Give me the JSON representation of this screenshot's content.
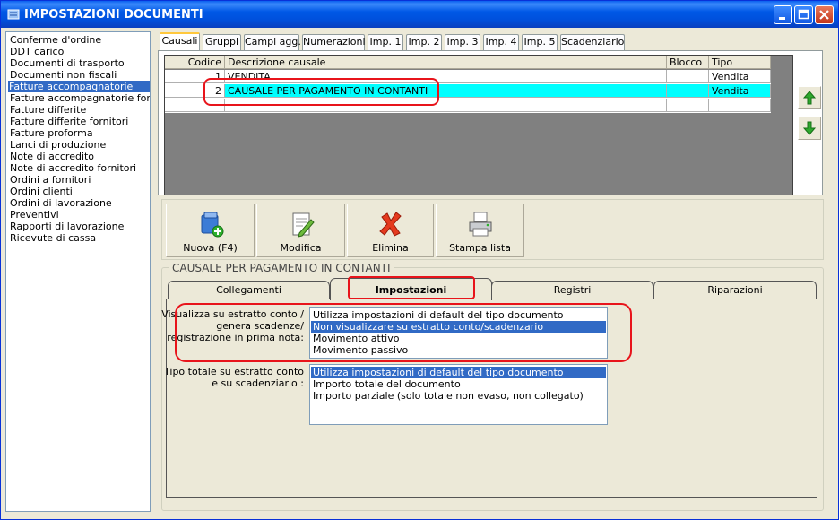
{
  "window": {
    "title": "IMPOSTAZIONI DOCUMENTI"
  },
  "left_list": {
    "items": [
      "Conferme d'ordine",
      "DDT carico",
      "Documenti di trasporto",
      "Documenti non fiscali",
      "Fatture accompagnatorie",
      "Fatture accompagnatorie fornitori",
      "Fatture differite",
      "Fatture differite fornitori",
      "Fatture proforma",
      "Lanci di produzione",
      "Note di accredito",
      "Note di accredito fornitori",
      "Ordini a fornitori",
      "Ordini clienti",
      "Ordini di lavorazione",
      "Preventivi",
      "Rapporti di lavorazione",
      "Ricevute di cassa"
    ],
    "selected_index": 4
  },
  "tabs": [
    "Causali",
    "Gruppi",
    "Campi agg.",
    "Numerazioni",
    "Imp. 1",
    "Imp. 2",
    "Imp. 3",
    "Imp. 4",
    "Imp. 5",
    "Scadenziario"
  ],
  "active_tab": "Causali",
  "grid": {
    "headers": [
      "Codice",
      "Descrizione causale",
      "Blocco",
      "Tipo"
    ],
    "rows": [
      {
        "codice": "1",
        "descrizione": "VENDITA",
        "blocco": "",
        "tipo": "Vendita"
      },
      {
        "codice": "2",
        "descrizione": "CAUSALE PER PAGAMENTO IN CONTANTI",
        "blocco": "",
        "tipo": "Vendita"
      }
    ],
    "selected_row": 1
  },
  "buttons": {
    "nuova": "Nuova (F4)",
    "modifica": "Modifica",
    "elimina": "Elimina",
    "stampa": "Stampa lista"
  },
  "group_title": "CAUSALE PER PAGAMENTO IN CONTANTI",
  "subtabs": [
    "Collegamenti",
    "Impostazioni",
    "Registri",
    "Riparazioni"
  ],
  "active_subtab": "Impostazioni",
  "settings": {
    "visualizza_label": [
      "Visualizza su estratto conto /",
      "genera scadenze/",
      "registrazione  in prima nota:"
    ],
    "visualizza_options": [
      "Utilizza impostazioni di default del tipo documento",
      "Non visualizzare su estratto conto/scadenzario",
      "Movimento attivo",
      "Movimento passivo"
    ],
    "visualizza_selected": 1,
    "tipo_totale_label": [
      "Tipo totale su estratto conto",
      "e su scadenziario :"
    ],
    "tipo_totale_options": [
      "Utilizza impostazioni di default del tipo documento",
      "Importo totale del documento",
      "Importo parziale (solo totale non evaso, non collegato)"
    ],
    "tipo_totale_selected": 0
  },
  "colors": {
    "selection": "#316AC5",
    "grid_selection": "#00FFFF",
    "highlight": "#E8141B"
  }
}
